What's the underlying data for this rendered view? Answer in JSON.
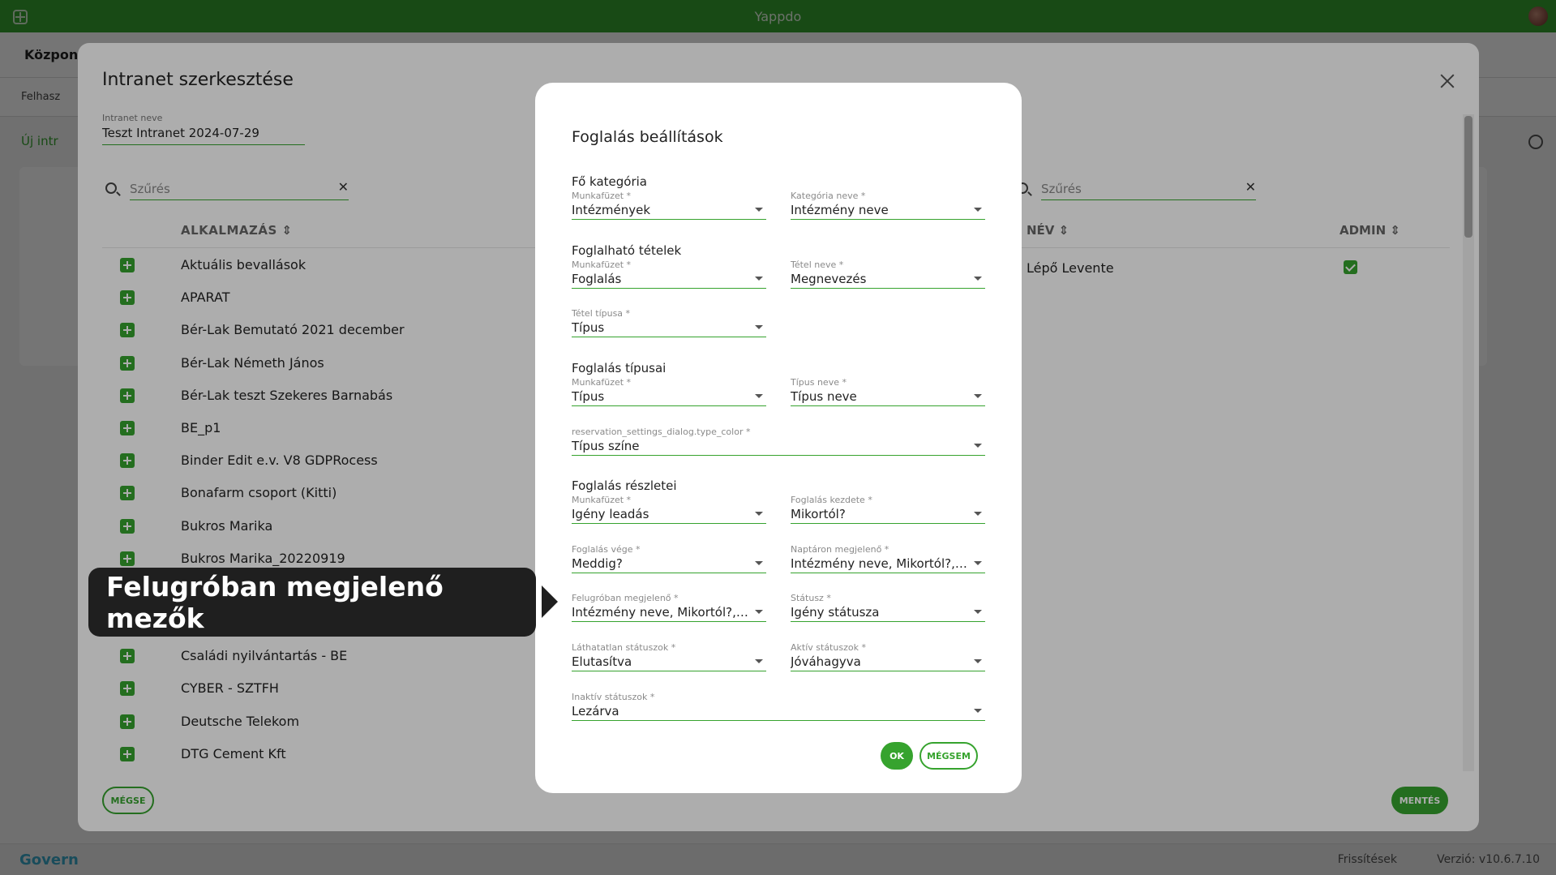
{
  "app": {
    "title": "Yappdo"
  },
  "background": {
    "breadcrumb": "Központi",
    "tab_label": "Felhasz",
    "new_button": "Új intr"
  },
  "footer": {
    "brand": "Govern",
    "refresh": "Frissítések",
    "version": "Verzió: v10.6.7.10"
  },
  "edit_dialog": {
    "title": "Intranet szerkesztése",
    "name_label": "Intranet neve",
    "name_value": "Teszt Intranet 2024-07-29",
    "left_search_placeholder": "Szűrés",
    "right_search_placeholder": "Szűrés",
    "apps_header": "ALKALMAZÁS ⇕",
    "apps": [
      "Aktuális bevallások",
      "APARAT",
      "Bér-Lak Bemutató 2021 december",
      "Bér-Lak Németh János",
      "Bér-Lak teszt Szekeres Barnabás",
      "BE_p1",
      "Binder Edit e.v. V8 GDPRocess",
      "Bonafarm csoport (Kitti)",
      "Bukros Marika",
      "Bukros Marika_20220919",
      "",
      "",
      "Családi nyilvántartás - BE",
      "CYBER - SZTFH",
      "Deutsche Telekom",
      "DTG Cement Kft"
    ],
    "users_header_name": "NÉV ⇕",
    "users_header_admin": "ADMIN ⇕",
    "users": [
      {
        "name": "Lépő Levente",
        "admin": true
      }
    ],
    "cancel_label": "MÉGSE",
    "save_label": "MENTÉS"
  },
  "settings_dialog": {
    "title": "Foglalás beállítások",
    "sections": {
      "main_category": "Fő kategória",
      "bookable_items": "Foglalható tételek",
      "booking_types": "Foglalás típusai",
      "booking_details": "Foglalás részletei"
    },
    "fields": {
      "mc_workbook_label": "Munkafüzet *",
      "mc_workbook_value": "Intézmények",
      "mc_name_label": "Kategória neve *",
      "mc_name_value": "Intézmény neve",
      "bi_workbook_label": "Munkafüzet *",
      "bi_workbook_value": "Foglalás",
      "bi_name_label": "Tétel neve *",
      "bi_name_value": "Megnevezés",
      "bi_type_label": "Tétel típusa *",
      "bi_type_value": "Típus",
      "bt_workbook_label": "Munkafüzet *",
      "bt_workbook_value": "Típus",
      "bt_name_label": "Típus neve *",
      "bt_name_value": "Típus neve",
      "bt_color_label": "reservation_settings_dialog.type_color *",
      "bt_color_value": "Típus színe",
      "bd_workbook_label": "Munkafüzet *",
      "bd_workbook_value": "Igény leadás",
      "bd_start_label": "Foglalás kezdete *",
      "bd_start_value": "Mikortól?",
      "bd_end_label": "Foglalás vége *",
      "bd_end_value": "Meddig?",
      "bd_calendar_label": "Naptáron megjelenő *",
      "bd_calendar_value": "Intézmény neve, Mikortól?, ...",
      "bd_popup_label": "Felugróban megjelenő *",
      "bd_popup_value": "Intézmény neve, Mikortól?, ...",
      "bd_status_label": "Státusz *",
      "bd_status_value": "Igény státusza",
      "bd_hidden_label": "Láthatatlan státuszok *",
      "bd_hidden_value": "Elutasítva",
      "bd_active_label": "Aktív státuszok *",
      "bd_active_value": "Jóváhagyva",
      "bd_inactive_label": "Inaktív státuszok *",
      "bd_inactive_value": "Lezárva"
    },
    "ok_label": "OK",
    "cancel_label": "MÉGSEM"
  },
  "callout": {
    "text": "Felugróban megjelenő mezők"
  },
  "colors": {
    "accent": "#36a32e",
    "callout_bg": "#1f1f1f"
  }
}
